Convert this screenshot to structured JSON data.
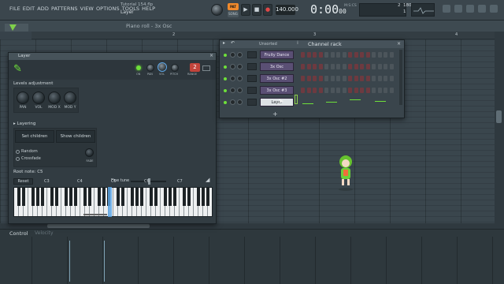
{
  "menu": [
    "FILE",
    "EDIT",
    "ADD",
    "PATTERNS",
    "VIEW",
    "OPTIONS",
    "TOOLS",
    "HELP"
  ],
  "hint": {
    "line1": "Tutorial 154.flp",
    "line2": "Layer"
  },
  "transport": {
    "pat_label": "PAT",
    "song_label": "SONG",
    "tempo": "140.000",
    "time_main": "0:00",
    "time_sub": "00",
    "msc": "M:S:CS"
  },
  "cpu": {
    "top": "2",
    "mid": "180 MB",
    "bottom": "1"
  },
  "piano_roll": {
    "title": "Piano roll - 3x Osc",
    "ruler_1": "2",
    "ruler_2": "3",
    "ruler_3": "4"
  },
  "layer": {
    "title": "Layer",
    "head_labels": {
      "on": "ON",
      "pan": "PAN",
      "vol": "VOL",
      "pitch": "PITCH",
      "range": "RANGE"
    },
    "range_value": "2",
    "levels_title": "Levels adjustment",
    "knobs": [
      "PAN",
      "VOL",
      "MOD X",
      "MOD Y"
    ],
    "layering_title": "Layering",
    "set_children": "Set children",
    "show_children": "Show children",
    "random": "Random",
    "crossfade": "Crossfade",
    "fade": "FADE",
    "root_note": "Root note: C5",
    "reset": "Reset",
    "fine_tune": "Fine tune",
    "octaves": [
      "C3",
      "C4",
      "C5",
      "C6",
      "C7"
    ]
  },
  "channel_rack": {
    "filter": "Unsorted",
    "title": "Channel rack",
    "channels": [
      "Fruity Dance",
      "3x Osc",
      "3x Osc #2",
      "3x Osc #3",
      "Layer"
    ],
    "add": "+"
  },
  "control": {
    "label": "Control",
    "sub": "Velocity"
  },
  "colors": {
    "accent": "#6ee03a",
    "pattern": "#f08a2c",
    "step_on": "#d9424a",
    "channel_btn": "#5a4f74"
  }
}
